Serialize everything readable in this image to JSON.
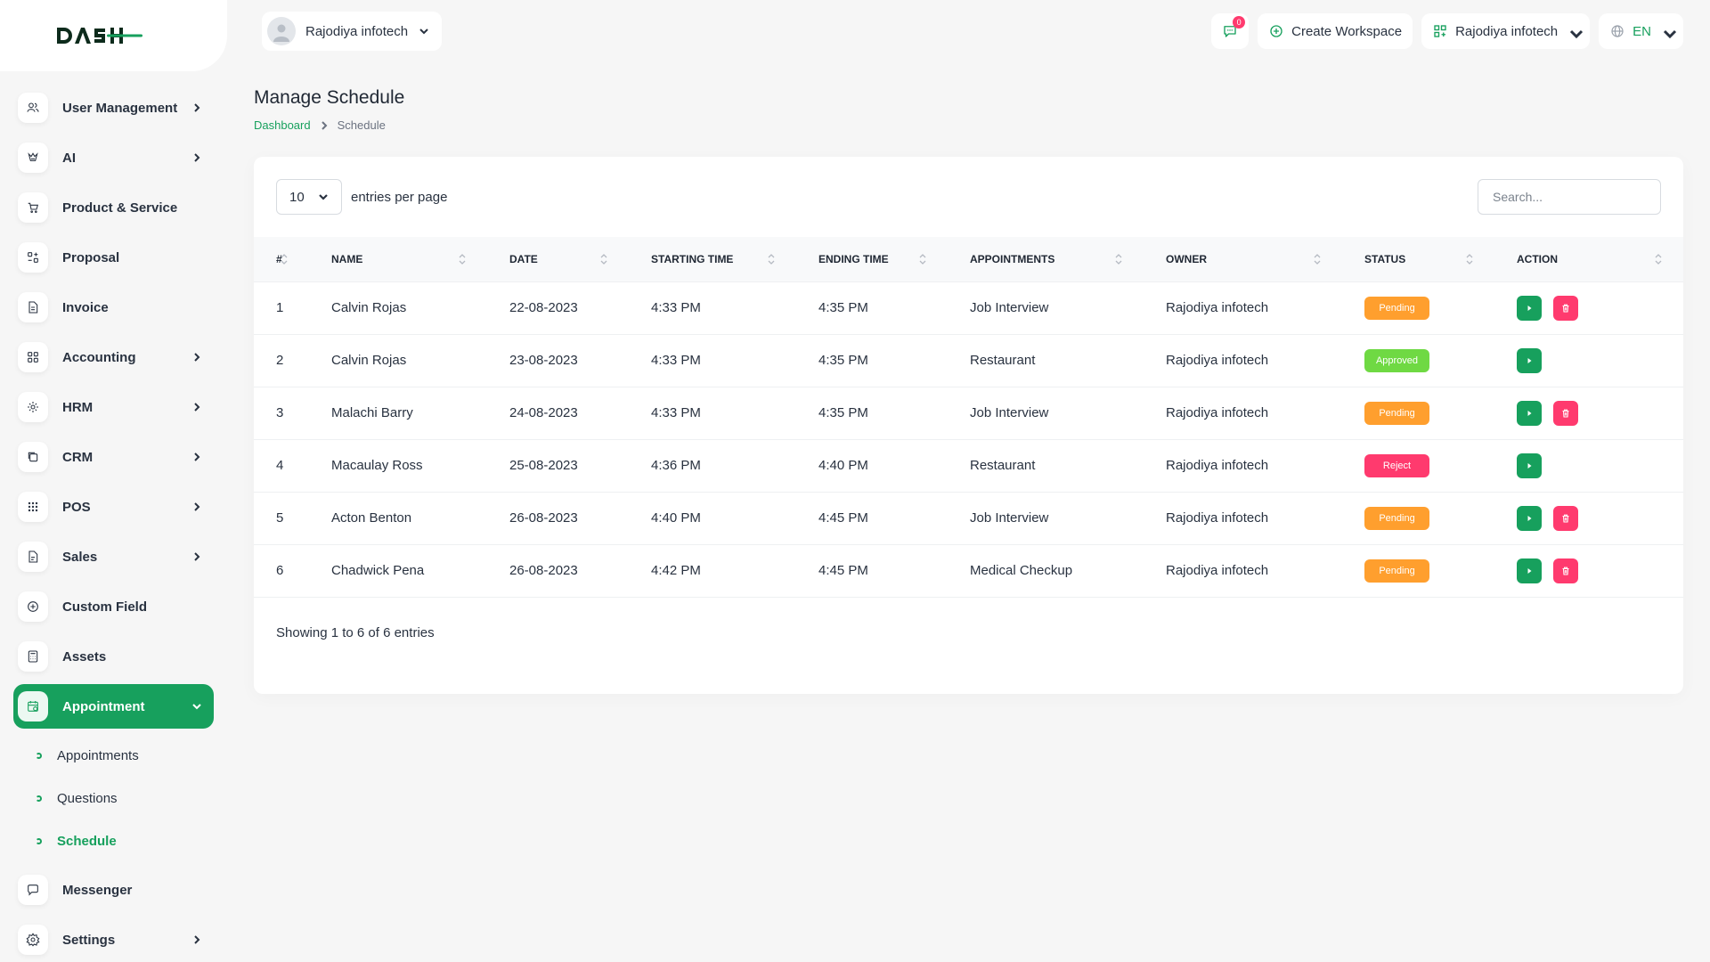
{
  "brand": {
    "logo_text": "DASH",
    "accent": "#17a05d"
  },
  "sidebar": {
    "items": [
      {
        "label": "User Management",
        "icon": "users-icon",
        "has_children": true
      },
      {
        "label": "AI",
        "icon": "ai-icon",
        "has_children": true
      },
      {
        "label": "Product & Service",
        "icon": "cart-icon",
        "has_children": false
      },
      {
        "label": "Proposal",
        "icon": "proposal-icon",
        "has_children": false
      },
      {
        "label": "Invoice",
        "icon": "invoice-icon",
        "has_children": false
      },
      {
        "label": "Accounting",
        "icon": "accounting-icon",
        "has_children": true
      },
      {
        "label": "HRM",
        "icon": "hrm-icon",
        "has_children": true
      },
      {
        "label": "CRM",
        "icon": "crm-icon",
        "has_children": true
      },
      {
        "label": "POS",
        "icon": "pos-icon",
        "has_children": true
      },
      {
        "label": "Sales",
        "icon": "sales-icon",
        "has_children": true
      },
      {
        "label": "Custom Field",
        "icon": "plus-circle-icon",
        "has_children": false
      },
      {
        "label": "Assets",
        "icon": "calculator-icon",
        "has_children": false
      },
      {
        "label": "Appointment",
        "icon": "calendar-icon",
        "has_children": true,
        "active": true
      }
    ],
    "appointment_children": [
      {
        "label": "Appointments"
      },
      {
        "label": "Questions"
      },
      {
        "label": "Schedule",
        "current": true
      }
    ],
    "bottom_items": [
      {
        "label": "Messenger",
        "icon": "chat-icon",
        "has_children": false
      },
      {
        "label": "Settings",
        "icon": "gear-icon",
        "has_children": true
      }
    ]
  },
  "header": {
    "user_name": "Rajodiya infotech",
    "message_count": "0",
    "create_workspace_label": "Create Workspace",
    "workspace_name": "Rajodiya infotech",
    "language": "EN"
  },
  "page": {
    "title": "Manage Schedule",
    "breadcrumb": {
      "home": "Dashboard",
      "current": "Schedule"
    }
  },
  "table_controls": {
    "per_page_value": "10",
    "per_page_label": "entries per page",
    "search_placeholder": "Search..."
  },
  "table": {
    "columns": [
      "#",
      "NAME",
      "DATE",
      "STARTING TIME",
      "ENDING TIME",
      "APPOINTMENTS",
      "OWNER",
      "STATUS",
      "ACTION"
    ],
    "rows": [
      {
        "num": "1",
        "name": "Calvin Rojas",
        "date": "22-08-2023",
        "start": "4:33 PM",
        "end": "4:35 PM",
        "appointment": "Job Interview",
        "owner": "Rajodiya infotech",
        "status": "Pending",
        "deletable": true
      },
      {
        "num": "2",
        "name": "Calvin Rojas",
        "date": "23-08-2023",
        "start": "4:33 PM",
        "end": "4:35 PM",
        "appointment": "Restaurant",
        "owner": "Rajodiya infotech",
        "status": "Approved",
        "deletable": false
      },
      {
        "num": "3",
        "name": "Malachi Barry",
        "date": "24-08-2023",
        "start": "4:33 PM",
        "end": "4:35 PM",
        "appointment": "Job Interview",
        "owner": "Rajodiya infotech",
        "status": "Pending",
        "deletable": true
      },
      {
        "num": "4",
        "name": "Macaulay Ross",
        "date": "25-08-2023",
        "start": "4:36 PM",
        "end": "4:40 PM",
        "appointment": "Restaurant",
        "owner": "Rajodiya infotech",
        "status": "Reject",
        "deletable": false
      },
      {
        "num": "5",
        "name": "Acton Benton",
        "date": "26-08-2023",
        "start": "4:40 PM",
        "end": "4:45 PM",
        "appointment": "Job Interview",
        "owner": "Rajodiya infotech",
        "status": "Pending",
        "deletable": true
      },
      {
        "num": "6",
        "name": "Chadwick Pena",
        "date": "26-08-2023",
        "start": "4:42 PM",
        "end": "4:45 PM",
        "appointment": "Medical Checkup",
        "owner": "Rajodiya infotech",
        "status": "Pending",
        "deletable": true
      }
    ],
    "footer": "Showing 1 to 6 of 6 entries"
  },
  "status_colors": {
    "Pending": "#ff9f2e",
    "Approved": "#6fd943",
    "Reject": "#ff3a6e"
  }
}
